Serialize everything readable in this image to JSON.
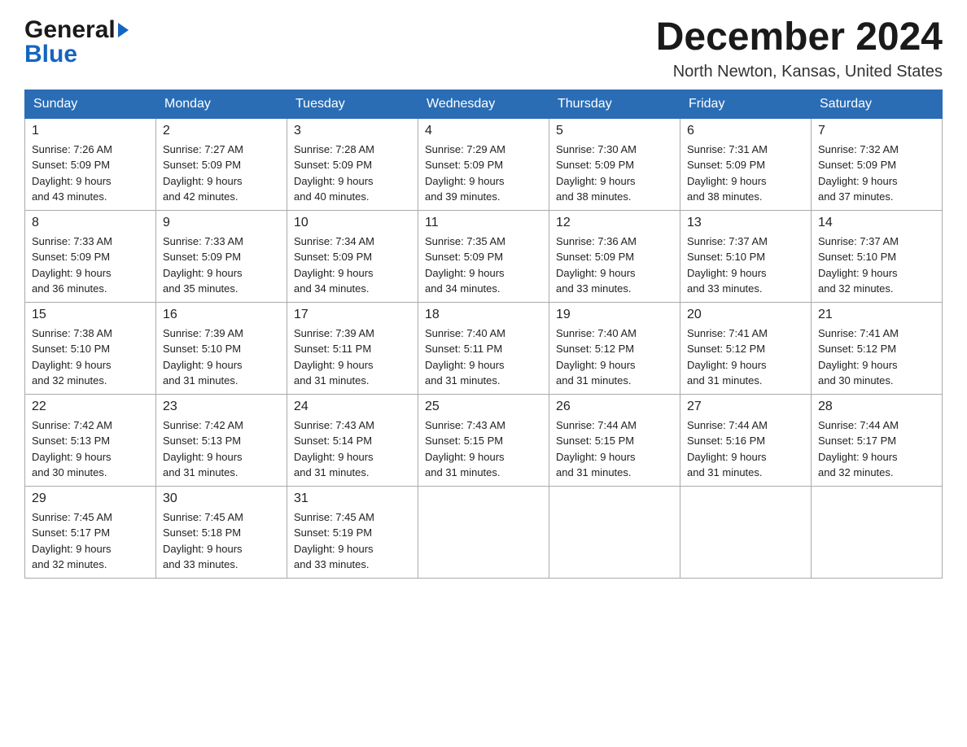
{
  "logo": {
    "line1": "General",
    "line2": "Blue"
  },
  "title": {
    "month_year": "December 2024",
    "location": "North Newton, Kansas, United States"
  },
  "headers": [
    "Sunday",
    "Monday",
    "Tuesday",
    "Wednesday",
    "Thursday",
    "Friday",
    "Saturday"
  ],
  "weeks": [
    [
      {
        "day": "1",
        "sunrise": "7:26 AM",
        "sunset": "5:09 PM",
        "daylight": "9 hours and 43 minutes."
      },
      {
        "day": "2",
        "sunrise": "7:27 AM",
        "sunset": "5:09 PM",
        "daylight": "9 hours and 42 minutes."
      },
      {
        "day": "3",
        "sunrise": "7:28 AM",
        "sunset": "5:09 PM",
        "daylight": "9 hours and 40 minutes."
      },
      {
        "day": "4",
        "sunrise": "7:29 AM",
        "sunset": "5:09 PM",
        "daylight": "9 hours and 39 minutes."
      },
      {
        "day": "5",
        "sunrise": "7:30 AM",
        "sunset": "5:09 PM",
        "daylight": "9 hours and 38 minutes."
      },
      {
        "day": "6",
        "sunrise": "7:31 AM",
        "sunset": "5:09 PM",
        "daylight": "9 hours and 38 minutes."
      },
      {
        "day": "7",
        "sunrise": "7:32 AM",
        "sunset": "5:09 PM",
        "daylight": "9 hours and 37 minutes."
      }
    ],
    [
      {
        "day": "8",
        "sunrise": "7:33 AM",
        "sunset": "5:09 PM",
        "daylight": "9 hours and 36 minutes."
      },
      {
        "day": "9",
        "sunrise": "7:33 AM",
        "sunset": "5:09 PM",
        "daylight": "9 hours and 35 minutes."
      },
      {
        "day": "10",
        "sunrise": "7:34 AM",
        "sunset": "5:09 PM",
        "daylight": "9 hours and 34 minutes."
      },
      {
        "day": "11",
        "sunrise": "7:35 AM",
        "sunset": "5:09 PM",
        "daylight": "9 hours and 34 minutes."
      },
      {
        "day": "12",
        "sunrise": "7:36 AM",
        "sunset": "5:09 PM",
        "daylight": "9 hours and 33 minutes."
      },
      {
        "day": "13",
        "sunrise": "7:37 AM",
        "sunset": "5:10 PM",
        "daylight": "9 hours and 33 minutes."
      },
      {
        "day": "14",
        "sunrise": "7:37 AM",
        "sunset": "5:10 PM",
        "daylight": "9 hours and 32 minutes."
      }
    ],
    [
      {
        "day": "15",
        "sunrise": "7:38 AM",
        "sunset": "5:10 PM",
        "daylight": "9 hours and 32 minutes."
      },
      {
        "day": "16",
        "sunrise": "7:39 AM",
        "sunset": "5:10 PM",
        "daylight": "9 hours and 31 minutes."
      },
      {
        "day": "17",
        "sunrise": "7:39 AM",
        "sunset": "5:11 PM",
        "daylight": "9 hours and 31 minutes."
      },
      {
        "day": "18",
        "sunrise": "7:40 AM",
        "sunset": "5:11 PM",
        "daylight": "9 hours and 31 minutes."
      },
      {
        "day": "19",
        "sunrise": "7:40 AM",
        "sunset": "5:12 PM",
        "daylight": "9 hours and 31 minutes."
      },
      {
        "day": "20",
        "sunrise": "7:41 AM",
        "sunset": "5:12 PM",
        "daylight": "9 hours and 31 minutes."
      },
      {
        "day": "21",
        "sunrise": "7:41 AM",
        "sunset": "5:12 PM",
        "daylight": "9 hours and 30 minutes."
      }
    ],
    [
      {
        "day": "22",
        "sunrise": "7:42 AM",
        "sunset": "5:13 PM",
        "daylight": "9 hours and 30 minutes."
      },
      {
        "day": "23",
        "sunrise": "7:42 AM",
        "sunset": "5:13 PM",
        "daylight": "9 hours and 31 minutes."
      },
      {
        "day": "24",
        "sunrise": "7:43 AM",
        "sunset": "5:14 PM",
        "daylight": "9 hours and 31 minutes."
      },
      {
        "day": "25",
        "sunrise": "7:43 AM",
        "sunset": "5:15 PM",
        "daylight": "9 hours and 31 minutes."
      },
      {
        "day": "26",
        "sunrise": "7:44 AM",
        "sunset": "5:15 PM",
        "daylight": "9 hours and 31 minutes."
      },
      {
        "day": "27",
        "sunrise": "7:44 AM",
        "sunset": "5:16 PM",
        "daylight": "9 hours and 31 minutes."
      },
      {
        "day": "28",
        "sunrise": "7:44 AM",
        "sunset": "5:17 PM",
        "daylight": "9 hours and 32 minutes."
      }
    ],
    [
      {
        "day": "29",
        "sunrise": "7:45 AM",
        "sunset": "5:17 PM",
        "daylight": "9 hours and 32 minutes."
      },
      {
        "day": "30",
        "sunrise": "7:45 AM",
        "sunset": "5:18 PM",
        "daylight": "9 hours and 33 minutes."
      },
      {
        "day": "31",
        "sunrise": "7:45 AM",
        "sunset": "5:19 PM",
        "daylight": "9 hours and 33 minutes."
      },
      null,
      null,
      null,
      null
    ]
  ],
  "labels": {
    "sunrise": "Sunrise:",
    "sunset": "Sunset:",
    "daylight": "Daylight:"
  }
}
